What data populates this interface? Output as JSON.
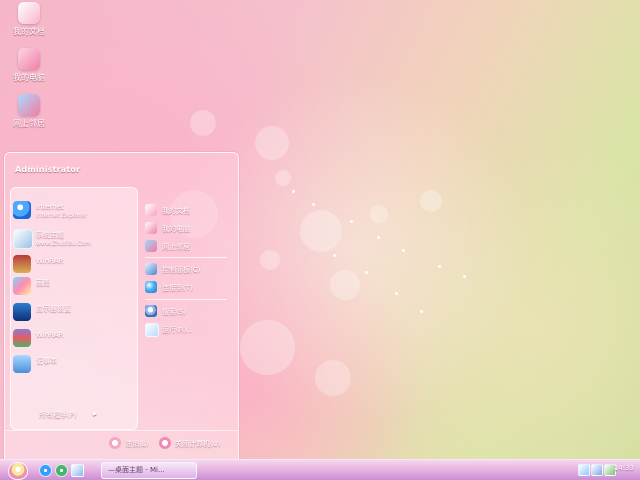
{
  "desktop": {
    "icons": [
      {
        "label": "我的文档",
        "icon": "documents-icon"
      },
      {
        "label": "我的电脑",
        "icon": "computer-icon"
      },
      {
        "label": "网上邻居",
        "icon": "network-icon"
      }
    ]
  },
  "start_menu": {
    "user": "Administrator",
    "left_items": [
      {
        "title": "Internet",
        "subtitle": "Internet Explorer",
        "icon": "ie-icon"
      },
      {
        "title": "系统主题",
        "subtitle": "www.Zhuti8u.Com",
        "icon": "theme-icon"
      },
      {
        "title": "WinRAR",
        "subtitle": "",
        "icon": "archive-icon"
      },
      {
        "title": "画图",
        "subtitle": "",
        "icon": "paint-icon"
      },
      {
        "title": "显示器设置",
        "subtitle": "",
        "icon": "monitor-icon"
      },
      {
        "title": "WinRAR",
        "subtitle": "",
        "icon": "stack-icon"
      },
      {
        "title": "记事本",
        "subtitle": "",
        "icon": "notepad-icon"
      }
    ],
    "right_items": [
      {
        "label": "我的文档",
        "icon": "documents-icon"
      },
      {
        "label": "我的电脑",
        "icon": "computer-icon"
      },
      {
        "label": "网上邻居",
        "icon": "network-icon"
      },
      {
        "label": "控制面板(C)",
        "icon": "control-panel-icon"
      },
      {
        "label": "连接到(T)",
        "icon": "globe-icon"
      },
      {
        "label": "搜索(S)",
        "icon": "search-icon"
      },
      {
        "label": "运行(R)...",
        "icon": "run-icon"
      }
    ],
    "all_programs": "所有程序(P)",
    "all_programs_arrow": "▸",
    "logoff": "注销(L)",
    "shutdown": "关闭计算机(U)"
  },
  "taskbar": {
    "task_label": "—桌面主题 - Mi...",
    "clock": "14:33"
  },
  "colors": {
    "accent_pink": "#f08fb0",
    "taskbar_purple": "#c98fd3"
  }
}
